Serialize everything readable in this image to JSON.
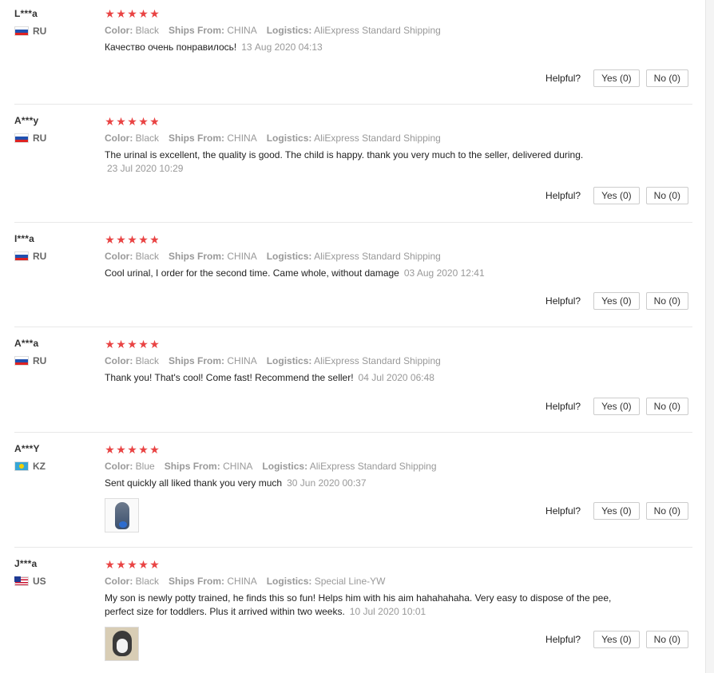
{
  "reviews": [
    {
      "user": "L***a",
      "country": "RU",
      "color_label": "Color:",
      "color": "Black",
      "ships_label": "Ships From:",
      "ships": "CHINA",
      "logistics_label": "Logistics:",
      "logistics": "AliExpress Standard Shipping",
      "text": "Качество очень понравилось!",
      "date": "13 Aug 2020 04:13",
      "rating": 5,
      "helpful": "Helpful?",
      "yes": "Yes (0)",
      "no": "No (0)"
    },
    {
      "user": "A***y",
      "country": "RU",
      "color_label": "Color:",
      "color": "Black",
      "ships_label": "Ships From:",
      "ships": "CHINA",
      "logistics_label": "Logistics:",
      "logistics": "AliExpress Standard Shipping",
      "text": "The urinal is excellent, the quality is good. The child is happy. thank you very much to the seller, delivered during.",
      "date": "23 Jul 2020 10:29",
      "rating": 4.8,
      "helpful": "Helpful?",
      "yes": "Yes (0)",
      "no": "No (0)"
    },
    {
      "user": "I***a",
      "country": "RU",
      "color_label": "Color:",
      "color": "Black",
      "ships_label": "Ships From:",
      "ships": "CHINA",
      "logistics_label": "Logistics:",
      "logistics": "AliExpress Standard Shipping",
      "text": "Cool urinal, I order for the second time. Came whole, without damage",
      "date": "03 Aug 2020 12:41",
      "rating": 4.8,
      "helpful": "Helpful?",
      "yes": "Yes (0)",
      "no": "No (0)"
    },
    {
      "user": "A***a",
      "country": "RU",
      "color_label": "Color:",
      "color": "Black",
      "ships_label": "Ships From:",
      "ships": "CHINA",
      "logistics_label": "Logistics:",
      "logistics": "AliExpress Standard Shipping",
      "text": "Thank you! That's cool! Come fast! Recommend the seller!",
      "date": "04 Jul 2020 06:48",
      "rating": 5,
      "helpful": "Helpful?",
      "yes": "Yes (0)",
      "no": "No (0)"
    },
    {
      "user": "A***Y",
      "country": "KZ",
      "color_label": "Color:",
      "color": "Blue",
      "ships_label": "Ships From:",
      "ships": "CHINA",
      "logistics_label": "Logistics:",
      "logistics": "AliExpress Standard Shipping",
      "text": "Sent quickly all liked thank you very much",
      "date": "30 Jun 2020 00:37",
      "rating": 5,
      "helpful": "Helpful?",
      "yes": "Yes (0)",
      "no": "No (0)"
    },
    {
      "user": "J***a",
      "country": "US",
      "color_label": "Color:",
      "color": "Black",
      "ships_label": "Ships From:",
      "ships": "CHINA",
      "logistics_label": "Logistics:",
      "logistics": "Special Line-YW",
      "text": "My son is newly potty trained, he finds this so fun! Helps him with his aim hahahahaha. Very easy to dispose of the pee, perfect size for toddlers. Plus it arrived within two weeks.",
      "date": "10 Jul 2020 10:01",
      "rating": 5,
      "helpful": "Helpful?",
      "yes": "Yes (0)",
      "no": "No (0)"
    }
  ],
  "colors": {
    "star": "#e94343",
    "muted": "#999999",
    "border": "#e8e8e8"
  }
}
